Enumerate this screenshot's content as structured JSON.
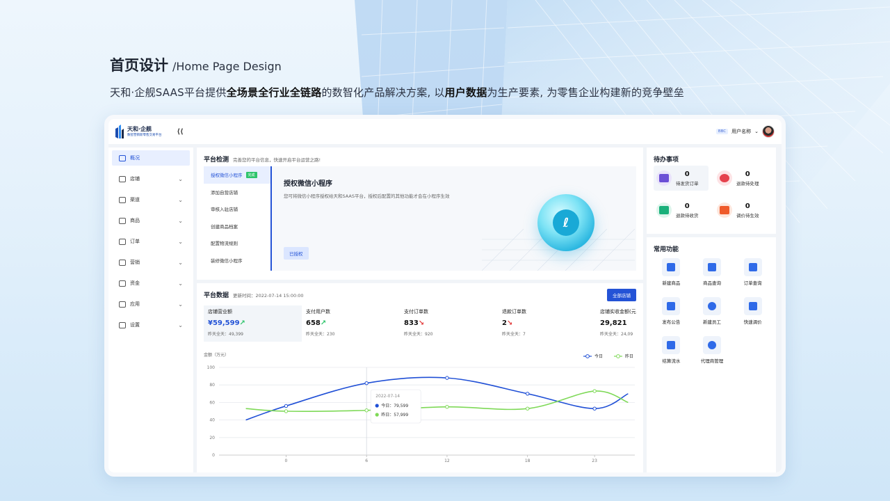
{
  "hero": {
    "title_cn": "首页设计",
    "title_en": "/Home Page Design",
    "subtitle_parts": [
      "天和·企舰SAAS平台提供",
      "全场景全行业全链路",
      "的数智化产品解决方案, 以",
      "用户数据",
      "为生产要素, 为零售企业构建新的竞争壁垒"
    ]
  },
  "topbar": {
    "logo_title": "天和·企舰",
    "logo_subtitle": "数智营销新零售交易平台",
    "collapse_label": "⟨⟨",
    "badge": "BBC",
    "user_name": "用户名称",
    "user_chevron": "⌄"
  },
  "sidebar": {
    "items": [
      {
        "label": "概况"
      },
      {
        "label": "店铺"
      },
      {
        "label": "渠道"
      },
      {
        "label": "商品"
      },
      {
        "label": "订单"
      },
      {
        "label": "营销"
      },
      {
        "label": "资金"
      },
      {
        "label": "应用"
      },
      {
        "label": "设置"
      }
    ],
    "chevron": "⌄"
  },
  "detect": {
    "title": "平台检测",
    "subtitle": "完善您的平台信息，快速开启平台运营之路!",
    "steps": [
      {
        "label": "授权微信小程序",
        "badge": "完成"
      },
      {
        "label": "添加自营店铺"
      },
      {
        "label": "审核入驻店铺"
      },
      {
        "label": "创建商品档案"
      },
      {
        "label": "配置物流规则"
      },
      {
        "label": "装修微信小程序"
      }
    ],
    "main_title": "授权微信小程序",
    "main_desc": "您可将微信小程序授权给天和SAAS平台，授权后配置的其他功能才会在小程序生效",
    "auth_button": "已授权"
  },
  "platform_data": {
    "title": "平台数据",
    "update_time": "更新时间：2022-07-14 15:00:00",
    "all_stores_button": "全部店铺",
    "stats": [
      {
        "label": "店铺营业额",
        "value": "¥59,599",
        "trend": "↗",
        "prev": "昨天全天：49,399"
      },
      {
        "label": "支付用户数",
        "value": "658",
        "trend": "↗",
        "prev": "昨天全天：230"
      },
      {
        "label": "支付订单数",
        "value": "833",
        "trend": "↘",
        "prev": "昨天全天：920"
      },
      {
        "label": "退款订单数",
        "value": "2",
        "trend": "↘",
        "prev": "昨天全天：7"
      },
      {
        "label": "店铺实收金额(元",
        "value": "29,821",
        "trend": "",
        "prev": "昨天全天：24,09"
      }
    ]
  },
  "chart_data": {
    "type": "line",
    "ylabel": "金额（万元）",
    "ylim": [
      0,
      100
    ],
    "yticks": [
      0,
      20,
      40,
      60,
      80,
      100
    ],
    "xlim": [
      -5,
      26
    ],
    "xticks": [
      0,
      6,
      12,
      18,
      23
    ],
    "x": [
      -3,
      0,
      6,
      12,
      18,
      23,
      25.5
    ],
    "series": [
      {
        "name": "今日",
        "color": "#1f4fd6",
        "values": [
          40,
          56,
          82,
          88,
          70,
          53,
          70
        ]
      },
      {
        "name": "昨日",
        "color": "#7ed957",
        "values": [
          53,
          50,
          51,
          55,
          53,
          73,
          60
        ]
      }
    ],
    "tooltip": {
      "date": "2022-07-14",
      "x": 6,
      "rows": [
        "今日：79,599",
        "昨日：57,999"
      ]
    },
    "legend_position": "top-right",
    "grid": true
  },
  "todo": {
    "title": "待办事项",
    "items": [
      {
        "num": "0",
        "label": "待发货订单",
        "color": "#6b4fd6"
      },
      {
        "num": "0",
        "label": "退款待处理",
        "color": "#e5424d"
      },
      {
        "num": "0",
        "label": "退款待收货",
        "color": "#19b07a"
      },
      {
        "num": "0",
        "label": "调价待生效",
        "color": "#ef5a2a"
      }
    ]
  },
  "functions": {
    "title": "常用功能",
    "items": [
      {
        "label": "新建商品"
      },
      {
        "label": "商品查询"
      },
      {
        "label": "订单查询"
      },
      {
        "label": "发布公告"
      },
      {
        "label": "新建员工"
      },
      {
        "label": "快速调价"
      },
      {
        "label": "结算流水"
      },
      {
        "label": "代理商管理"
      }
    ]
  }
}
